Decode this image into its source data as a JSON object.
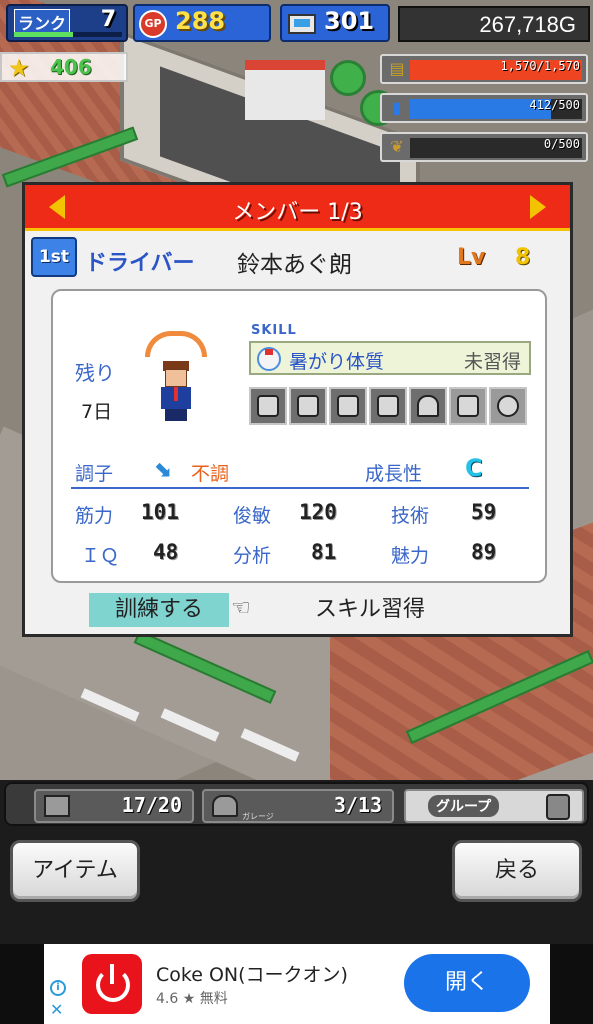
{
  "hud": {
    "rank_label": "ランク",
    "rank_value": "7",
    "gp_icon": "GP",
    "gp_value": "288",
    "pc_value": "301",
    "money": "267,718G",
    "stars": "406",
    "resources": [
      {
        "icon": "money-stack-icon",
        "text": "1,570/1,570",
        "fill_pct": 100,
        "color": "#ee4422"
      },
      {
        "icon": "drink-bottle-icon",
        "text": "412/500",
        "fill_pct": 82,
        "color": "#2a7ae6"
      },
      {
        "icon": "wheat-icon",
        "text": "0/500",
        "fill_pct": 0,
        "color": "#888888"
      }
    ]
  },
  "dialog": {
    "title": "メンバー 1/3",
    "rank_badge": "1st",
    "role": "ドライバー",
    "name": "鈴本あぐ朗",
    "lv_label": "Lv",
    "lv_value": "8",
    "remain_label": "残り",
    "remain_value": "7日",
    "skill_heading": "SKILL",
    "skill_name": "暑がり体質",
    "skill_status": "未習得",
    "condition_label": "調子",
    "condition_value": "不調",
    "growth_label": "成長性",
    "growth_value": "C",
    "stats": {
      "str_label": "筋力",
      "str_value": "101",
      "agi_label": "俊敏",
      "agi_value": "120",
      "tech_label": "技術",
      "tech_value": "59",
      "iq_label": "ＩＱ",
      "iq_value": "48",
      "ana_label": "分析",
      "ana_value": "81",
      "cha_label": "魅力",
      "cha_value": "89"
    },
    "train_button": "訓練する",
    "skill_button": "スキル習得"
  },
  "bottom": {
    "counter1": "17/20",
    "counter2": "3/13",
    "counter2_sub": "ガレージ",
    "group_label": "グループ",
    "item_button": "アイテム",
    "back_button": "戻る"
  },
  "ad": {
    "app_name": "Coke ON(コークオン)",
    "rating": "4.6 ★  無料",
    "open_button": "開く",
    "brand_color": "#e8131b"
  }
}
